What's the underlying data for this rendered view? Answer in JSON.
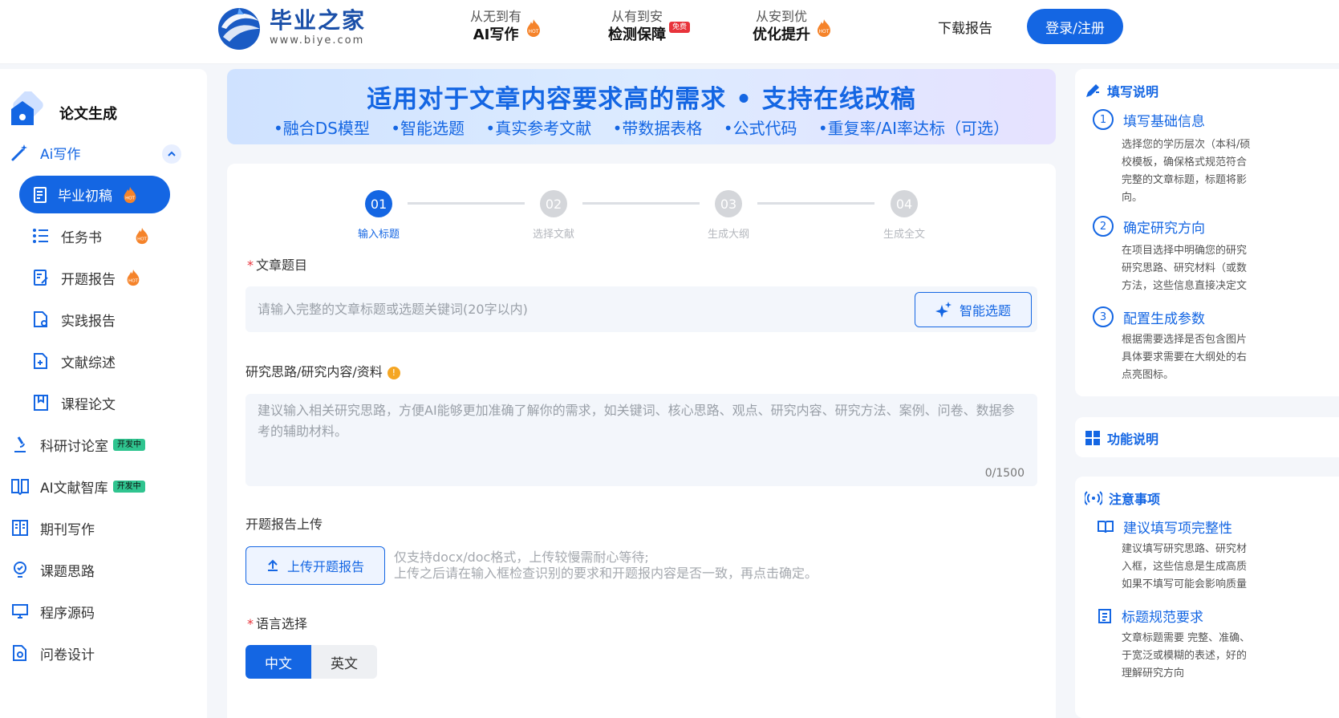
{
  "header": {
    "logo_title": "毕业之家",
    "logo_url": "www.biye.com",
    "promos": [
      {
        "top": "从无到有",
        "bottom": "AI写作",
        "badge": "HOT"
      },
      {
        "top": "从有到安",
        "bottom": "检测保障",
        "badge": "免费"
      },
      {
        "top": "从安到优",
        "bottom": "优化提升",
        "badge": "HOT"
      }
    ],
    "download": "下载报告",
    "login": "登录/注册"
  },
  "sidebar": {
    "head_title": "论文生成",
    "ai_group": "Ai写作",
    "items": [
      {
        "label": "毕业初稿",
        "hot": true
      },
      {
        "label": "任务书",
        "hot": true
      },
      {
        "label": "开题报告",
        "hot": true
      },
      {
        "label": "实践报告"
      },
      {
        "label": "文献综述"
      },
      {
        "label": "课程论文"
      }
    ],
    "others": [
      {
        "label": "科研讨论室",
        "badge": "开发中"
      },
      {
        "label": "AI文献智库",
        "badge": "开发中"
      },
      {
        "label": "期刊写作"
      },
      {
        "label": "课题思路"
      },
      {
        "label": "程序源码"
      },
      {
        "label": "问卷设计"
      }
    ],
    "hot_text": "HOT"
  },
  "banner": {
    "title": "适用对于文章内容要求高的需求 • 支持在线改稿",
    "features": [
      "•融合DS模型",
      "•智能选题",
      "•真实参考文献",
      "•带数据表格",
      "•公式代码",
      "•重复率/AI率达标（可选）"
    ]
  },
  "steps": [
    {
      "num": "01",
      "label": "输入标题"
    },
    {
      "num": "02",
      "label": "选择文献"
    },
    {
      "num": "03",
      "label": "生成大纲"
    },
    {
      "num": "04",
      "label": "生成全文"
    }
  ],
  "form": {
    "title_label": "文章题目",
    "title_placeholder": "请输入完整的文章标题或选题关键词(20字以内)",
    "smart_btn": "智能选题",
    "research_label": "研究思路/研究内容/资料",
    "info_mark": "!",
    "research_placeholder": "建议输入相关研究思路，方便AI能够更加准确了解你的需求，如关键词、核心思路、观点、研究内容、研究方法、案例、问卷、数据参考的辅助材料。",
    "counter": "0/1500",
    "upload_label": "开题报告上传",
    "upload_btn": "上传开题报告",
    "upload_hint1": "仅支持docx/doc格式，上传较慢需耐心等待;",
    "upload_hint2": "上传之后请在输入框检查识别的要求和开题报内容是否一致，再点击确定。",
    "lang_label": "语言选择",
    "lang_cn": "中文",
    "lang_en": "英文"
  },
  "right": {
    "guide_title": "填写说明",
    "steps": [
      {
        "num": "1",
        "title": "填写基础信息",
        "lines": [
          "选择您的学历层次（本科/硕",
          "校模板，确保格式规范符合",
          "完整的文章标题，标题将影",
          "向。"
        ]
      },
      {
        "num": "2",
        "title": "确定研究方向",
        "lines": [
          "在项目选择中明确您的研究",
          "研究思路、研究材料（或数",
          "方法，这些信息直接决定文"
        ]
      },
      {
        "num": "3",
        "title": "配置生成参数",
        "lines": [
          "根据需要选择是否包含图片",
          "具体要求需要在大纲处的右",
          "点亮图标。"
        ]
      }
    ],
    "feature_title": "功能说明",
    "notice_title": "注意事项",
    "notes": [
      {
        "title": "建议填写项完整性",
        "lines": [
          "建议填写研究思路、研究材",
          "入框，这些信息是生成高质",
          "如果不填写可能会影响质量"
        ]
      },
      {
        "title": "标题规范要求",
        "lines": [
          "文章标题需要 完整、准确、",
          "于宽泛或模糊的表述，好的",
          "理解研究方向"
        ]
      }
    ]
  },
  "colors": {
    "primary": "#1466e3",
    "hot": "#f5832a",
    "dev": "#2fc48f"
  }
}
